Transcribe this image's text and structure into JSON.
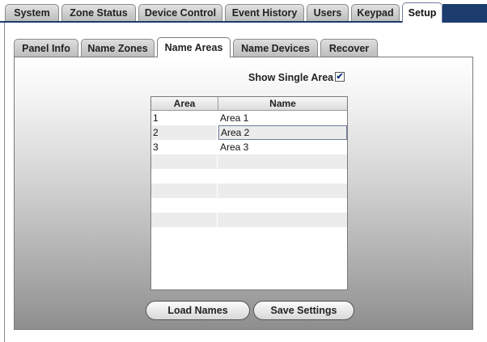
{
  "top_tabs": [
    {
      "label": "System"
    },
    {
      "label": "Zone Status"
    },
    {
      "label": "Device Control"
    },
    {
      "label": "Event History"
    },
    {
      "label": "Users"
    },
    {
      "label": "Keypad"
    },
    {
      "label": "Setup",
      "active": true
    }
  ],
  "sub_tabs": [
    {
      "label": "Panel Info"
    },
    {
      "label": "Name Zones"
    },
    {
      "label": "Name Areas",
      "active": true
    },
    {
      "label": "Name Devices"
    },
    {
      "label": "Recover"
    }
  ],
  "show_single_area": {
    "label": "Show Single Area",
    "checked": true,
    "check_glyph": "✔"
  },
  "table": {
    "columns": [
      "Area",
      "Name"
    ],
    "rows": [
      {
        "area": "1",
        "name": "Area 1"
      },
      {
        "area": "2",
        "name": "Area 2",
        "selected": true
      },
      {
        "area": "3",
        "name": "Area 3"
      },
      {
        "area": "",
        "name": ""
      },
      {
        "area": "",
        "name": ""
      },
      {
        "area": "",
        "name": ""
      },
      {
        "area": "",
        "name": ""
      },
      {
        "area": "",
        "name": ""
      }
    ]
  },
  "buttons": {
    "load_names": "Load Names",
    "save_settings": "Save Settings"
  },
  "colors": {
    "accent": "#1c3c6e"
  }
}
